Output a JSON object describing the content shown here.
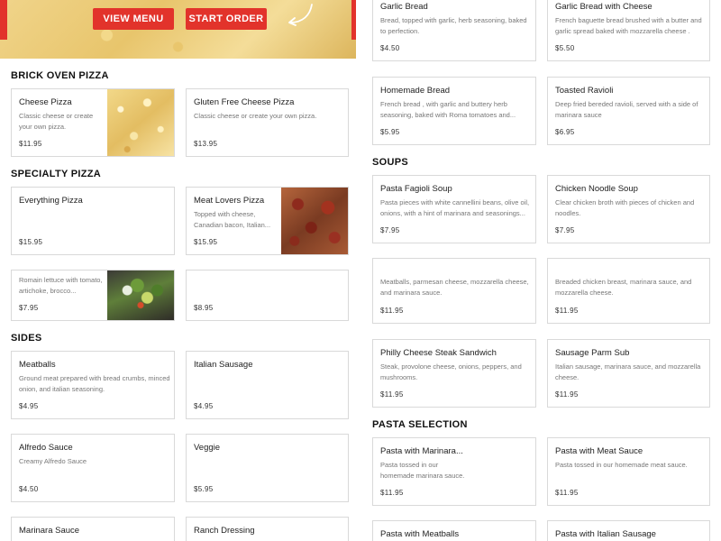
{
  "hero": {
    "view_menu_label": "VIEW MENU",
    "start_order_label": "START ORDER"
  },
  "sections": {
    "brick_oven": "BRICK OVEN PIZZA",
    "specialty": "SPECIALTY PIZZA",
    "sides": "SIDES",
    "soups": "SOUPS",
    "pasta": "PASTA SELECTION"
  },
  "items": {
    "cheese_pizza": {
      "name": "Cheese Pizza",
      "desc": "Classic cheese or create your own pizza.",
      "price": "$11.95"
    },
    "gluten_free": {
      "name": "Gluten Free Cheese Pizza",
      "desc": "Classic cheese or create your own pizza.",
      "price": "$13.95"
    },
    "everything": {
      "name": "Everything Pizza",
      "desc": "",
      "price": "$15.95"
    },
    "meat_lovers": {
      "name": "Meat Lovers Pizza",
      "desc": "Topped with cheese, Canadian bacon, Italian...",
      "price": "$15.95"
    },
    "salad": {
      "name": "",
      "desc": "Romain lettuce with tomato, artichoke, brocco...",
      "price": "$7.95"
    },
    "unnamed": {
      "name": "",
      "desc": "",
      "price": "$8.95"
    },
    "meatballs": {
      "name": "Meatballs",
      "desc": "Ground meat prepared with bread crumbs, minced onion, and italian seasoning.",
      "price": "$4.95"
    },
    "italian_sausage": {
      "name": "Italian Sausage",
      "desc": "",
      "price": "$4.95"
    },
    "alfredo": {
      "name": "Alfredo Sauce",
      "desc": "Creamy Alfredo Sauce",
      "price": "$4.50"
    },
    "veggie": {
      "name": "Veggie",
      "desc": "",
      "price": "$5.95"
    },
    "marinara_sauce": {
      "name": "Marinara Sauce",
      "desc": "",
      "price": ""
    },
    "ranch": {
      "name": "Ranch Dressing",
      "desc": "",
      "price": ""
    },
    "garlic_bread": {
      "name": "Garlic Bread",
      "desc": "Bread, topped with garlic, herb seasoning, baked to perfection.",
      "price": "$4.50"
    },
    "garlic_bread_cheese": {
      "name": "Garlic Bread with Cheese",
      "desc": "French baguette bread brushed with a butter and garlic spread baked with mozzarella cheese .",
      "price": "$5.50"
    },
    "homemade_bread": {
      "name": "Homemade Bread",
      "desc": "French bread , with garlic and buttery herb seasoning, baked with Roma tomatoes and...",
      "price": "$5.95"
    },
    "toasted_ravioli": {
      "name": "Toasted Ravioli",
      "desc": "Deep fried bereded ravioli, served with a side of marinara sauce",
      "price": "$6.95"
    },
    "pasta_fagioli": {
      "name": "Pasta Fagioli Soup",
      "desc": "Pasta pieces with white cannellini beans, olive oil, onions, with a hint of marinara and seasonings...",
      "price": "$7.95"
    },
    "chicken_noodle": {
      "name": "Chicken Noodle Soup",
      "desc": "Clear chicken broth with pieces of chicken and noodles.",
      "price": "$7.95"
    },
    "meatball_sub": {
      "name": "",
      "desc": "Meatballs, parmesan cheese, mozzarella cheese, and marinara sauce.",
      "price": "$11.95"
    },
    "chicken_parm_sub": {
      "name": "",
      "desc": "Breaded chicken breast, marinara sauce, and mozzarella cheese.",
      "price": "$11.95"
    },
    "philly": {
      "name": "Philly Cheese Steak Sandwich",
      "desc": "Steak, provolone cheese, onions, peppers, and mushrooms.",
      "price": "$11.95"
    },
    "sausage_parm": {
      "name": "Sausage Parm Sub",
      "desc": "Italian sausage, marinara sauce, and mozzarella cheese.",
      "price": "$11.95"
    },
    "pasta_marinara": {
      "name": "Pasta with Marinara...",
      "desc": "Pasta tossed in our homemade marinara sauce.",
      "price": "$11.95"
    },
    "pasta_meat": {
      "name": "Pasta with Meat Sauce",
      "desc": "Pasta tossed in our homemade meat sauce.",
      "price": "$11.95"
    },
    "pasta_meatballs": {
      "name": "Pasta with Meatballs",
      "desc": "",
      "price": ""
    },
    "pasta_sausage": {
      "name": "Pasta with Italian Sausage",
      "desc": "",
      "price": ""
    }
  }
}
